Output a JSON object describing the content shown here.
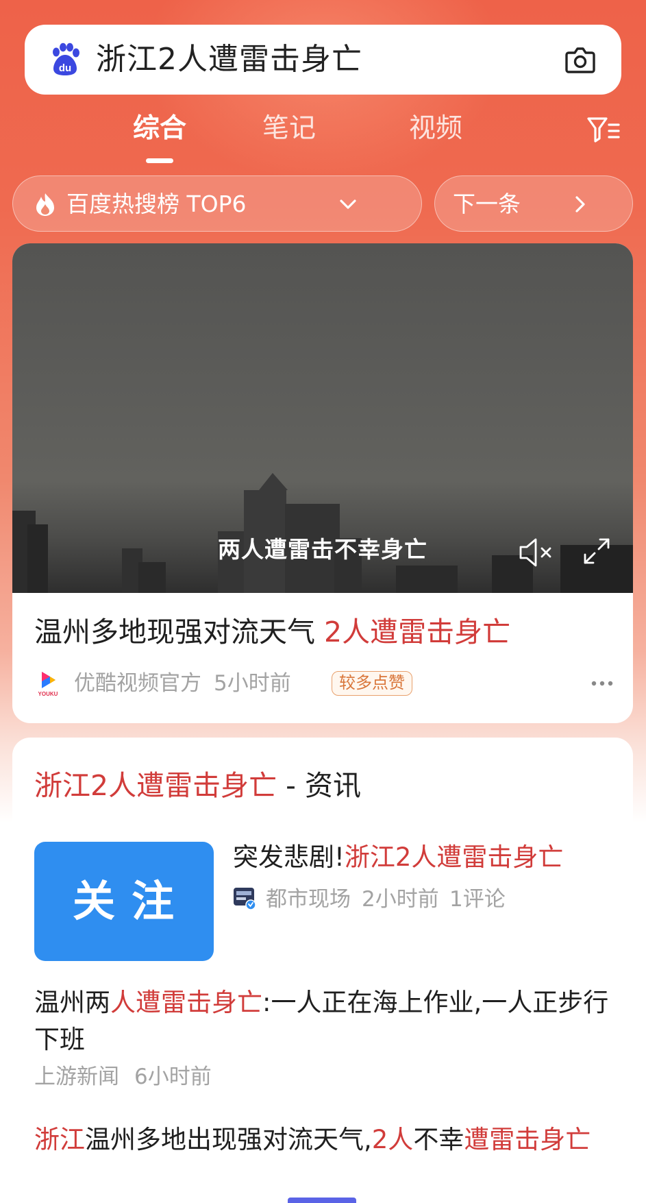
{
  "search": {
    "query": "浙江2人遭雷击身亡"
  },
  "tabs": [
    {
      "label": "综合",
      "active": true
    },
    {
      "label": "笔记",
      "active": false
    },
    {
      "label": "视频",
      "active": false
    }
  ],
  "chips": {
    "hot_label": "百度热搜榜 TOP6",
    "next_label": "下一条"
  },
  "video_card": {
    "video_caption": "两人遭雷击不幸身亡",
    "title_plain": "温州多地现强对流天气 ",
    "title_highlight": "2人遭雷击身亡",
    "source": "优酷视频官方",
    "time": "5小时前",
    "badge": "较多点赞"
  },
  "news_card": {
    "title_highlight": "浙江2人遭雷击身亡",
    "title_suffix": " - 资讯",
    "thumbnail_text": "关注",
    "item1": {
      "title_plain": "突发悲剧!",
      "title_highlight": "浙江2人遭雷击身亡",
      "source": "都市现场",
      "time": "2小时前",
      "comments": "1评论"
    },
    "item2": {
      "part1": "温州两",
      "part2": "人遭雷击身亡",
      "part3": ":一人正在海上作业,一人正步行下班",
      "source": "上游新闻",
      "time": "6小时前"
    },
    "item3": {
      "part1": "浙江",
      "part2": "温州多地出现强对流天气,",
      "part3": "2人",
      "part4": "不幸",
      "part5": "遭雷击身亡"
    }
  },
  "colors": {
    "brand_red": "#ee6249",
    "highlight": "#d13c3a",
    "baidu_blue": "#3b48e0",
    "thumb_blue": "#2f8ef0"
  }
}
